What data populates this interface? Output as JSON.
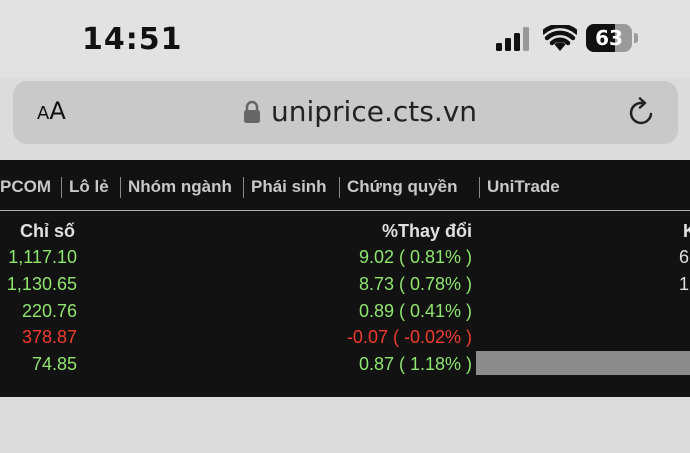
{
  "status_bar": {
    "time": "14:51",
    "battery_level": "63",
    "battery_fraction": 0.63,
    "icons": [
      "signal-icon",
      "wifi-icon",
      "battery-icon"
    ]
  },
  "browser": {
    "aa_small": "A",
    "aa_large": "A",
    "url": "uniprice.cts.vn",
    "icons": [
      "lock-icon",
      "reload-icon"
    ]
  },
  "nav": {
    "items": [
      "PCOM",
      "Lô lẻ",
      "Nhóm ngành",
      "Phái sinh",
      "Chứng quyền",
      "UniTrade"
    ]
  },
  "table": {
    "headers": {
      "index": "Chỉ số",
      "change": "%Thay đổi",
      "next": "K"
    },
    "rows": [
      {
        "index": "1,117.10",
        "change": "9.02 ( 0.81% )",
        "next": "6",
        "trend": "up"
      },
      {
        "index": "1,130.65",
        "change": "8.73 ( 0.78% )",
        "next": "1",
        "trend": "up"
      },
      {
        "index": "220.76",
        "change": "0.89 ( 0.41% )",
        "next": "",
        "trend": "up"
      },
      {
        "index": "378.87",
        "change": "-0.07 ( -0.02% )",
        "next": "",
        "trend": "down"
      },
      {
        "index": "74.85",
        "change": "0.87 ( 1.18% )",
        "next": "",
        "trend": "up"
      }
    ]
  },
  "colors": {
    "up": "#8ee66f",
    "down": "#ef3b2f",
    "background": "#121212"
  }
}
